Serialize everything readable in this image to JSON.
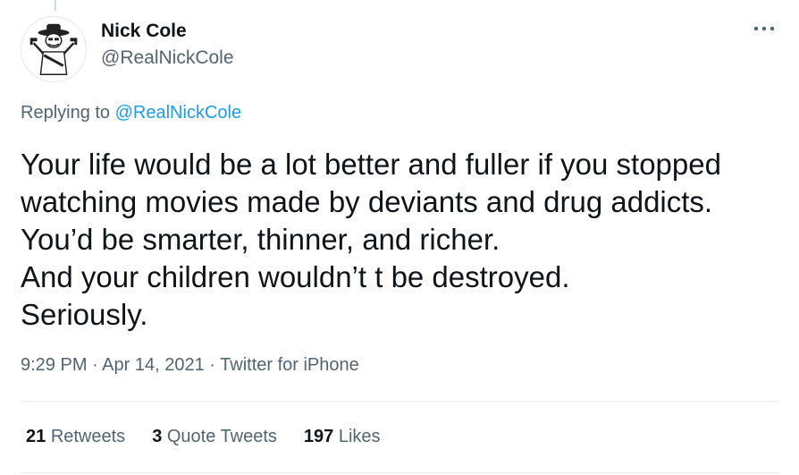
{
  "author": {
    "display_name": "Nick Cole",
    "handle": "@RealNickCole",
    "avatar_icon": "cartoon-gunslinger-avatar"
  },
  "more_icon": "more-horizontal-icon",
  "reply": {
    "prefix": "Replying to",
    "mention": "@RealNickCole"
  },
  "tweet": {
    "lines": [
      "Your life would be a lot better and fuller if you stopped",
      "watching movies made by deviants and drug addicts.",
      "You’d be smarter, thinner, and richer.",
      "And your children wouldn’t t be destroyed.",
      "Seriously."
    ]
  },
  "meta": {
    "time": "9:29 PM",
    "date": "Apr 14, 2021",
    "source": "Twitter for iPhone",
    "separator": "·"
  },
  "stats": {
    "retweets_count": "21",
    "retweets_label": "Retweets",
    "quotes_count": "3",
    "quotes_label": "Quote Tweets",
    "likes_count": "197",
    "likes_label": "Likes"
  },
  "colors": {
    "text": "#0f1419",
    "secondary": "#536471",
    "link": "#1d9bf0",
    "divider": "#e6ecf0"
  }
}
